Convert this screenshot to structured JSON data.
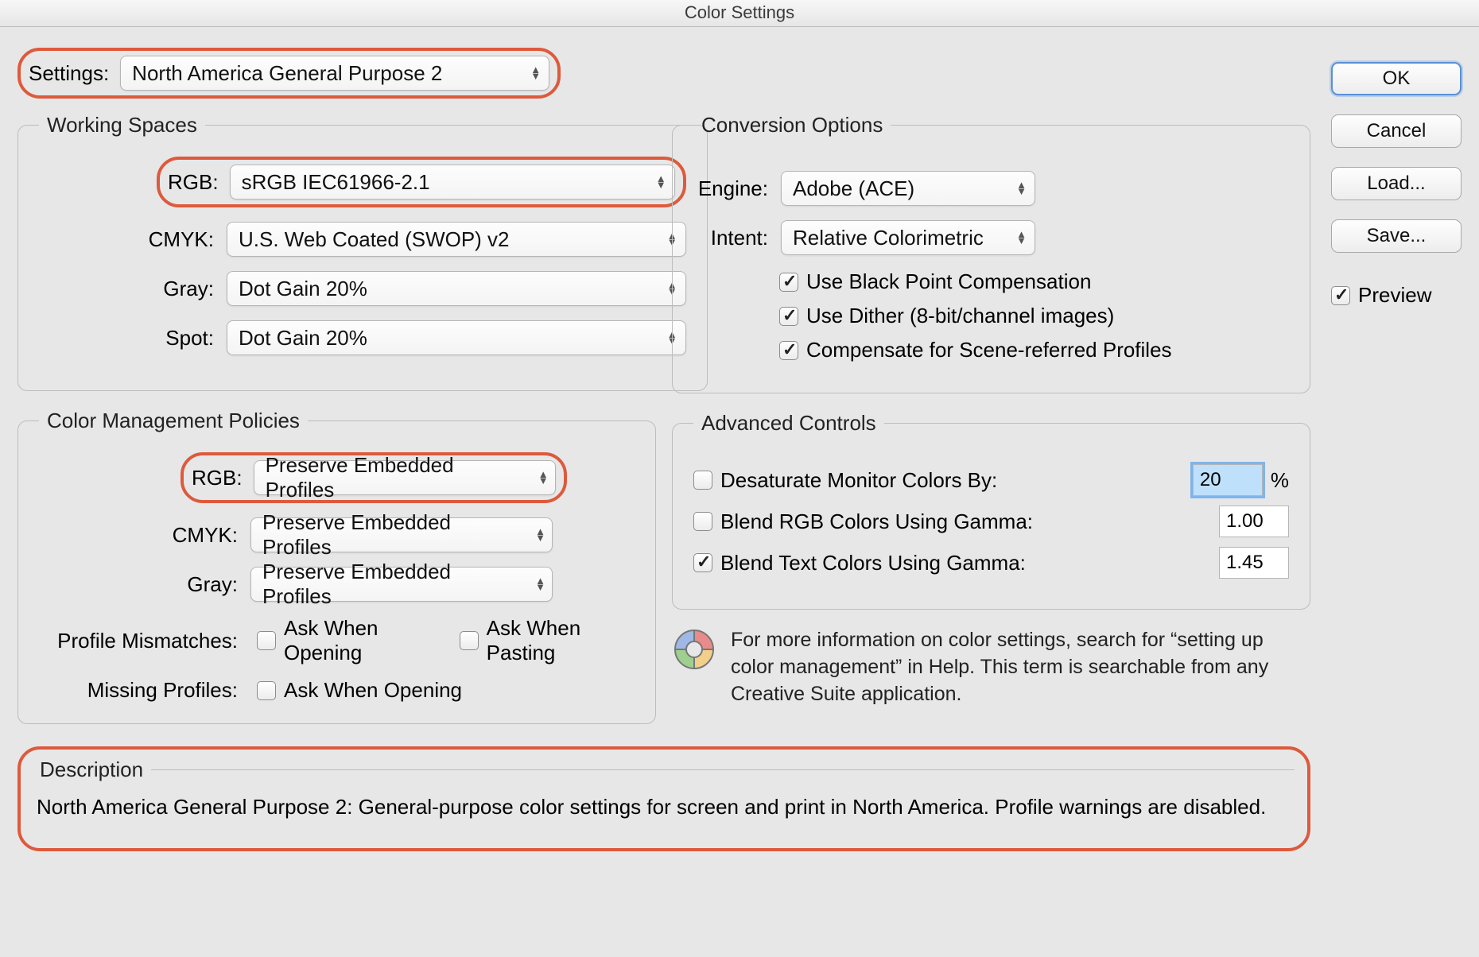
{
  "window": {
    "title": "Color Settings"
  },
  "settings": {
    "label": "Settings:",
    "value": "North America General Purpose 2"
  },
  "working_spaces": {
    "legend": "Working Spaces",
    "rgb": {
      "label": "RGB:",
      "value": "sRGB IEC61966-2.1"
    },
    "cmyk": {
      "label": "CMYK:",
      "value": "U.S. Web Coated (SWOP) v2"
    },
    "gray": {
      "label": "Gray:",
      "value": "Dot Gain 20%"
    },
    "spot": {
      "label": "Spot:",
      "value": "Dot Gain 20%"
    }
  },
  "policies": {
    "legend": "Color Management Policies",
    "rgb": {
      "label": "RGB:",
      "value": "Preserve Embedded Profiles"
    },
    "cmyk": {
      "label": "CMYK:",
      "value": "Preserve Embedded Profiles"
    },
    "gray": {
      "label": "Gray:",
      "value": "Preserve Embedded Profiles"
    },
    "profile_mismatches": {
      "label": "Profile Mismatches:",
      "ask_opening": "Ask When Opening",
      "ask_pasting": "Ask When Pasting"
    },
    "missing_profiles": {
      "label": "Missing Profiles:",
      "ask_opening": "Ask When Opening"
    }
  },
  "conversion": {
    "legend": "Conversion Options",
    "engine": {
      "label": "Engine:",
      "value": "Adobe (ACE)"
    },
    "intent": {
      "label": "Intent:",
      "value": "Relative Colorimetric"
    },
    "blackpoint": "Use Black Point Compensation",
    "dither": "Use Dither (8-bit/channel images)",
    "compensate": "Compensate for Scene-referred Profiles"
  },
  "advanced": {
    "legend": "Advanced Controls",
    "desaturate": {
      "label": "Desaturate Monitor Colors By:",
      "value": "20",
      "suffix": "%"
    },
    "blend_rgb": {
      "label": "Blend RGB Colors Using Gamma:",
      "value": "1.00"
    },
    "blend_text": {
      "label": "Blend Text Colors Using Gamma:",
      "value": "1.45"
    }
  },
  "info_text": "For more information on color settings, search for “setting up color management” in Help. This term is searchable from any Creative Suite application.",
  "description": {
    "legend": "Description",
    "text": "North America General Purpose 2:  General-purpose color settings for screen and print in North America. Profile warnings are disabled."
  },
  "buttons": {
    "ok": "OK",
    "cancel": "Cancel",
    "load": "Load...",
    "save": "Save...",
    "preview": "Preview"
  }
}
